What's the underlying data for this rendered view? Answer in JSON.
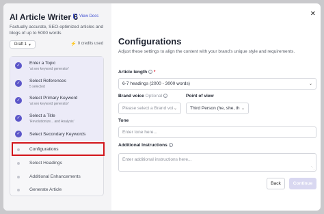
{
  "sidebar": {
    "title": "AI Article Writer 6",
    "docs_link": "View Docs",
    "description": "Factually accurate, SEO-optimized articles and blogs of up to 5000 words",
    "draft_label": "Draft 1",
    "credits_label": "0 credits used",
    "steps": [
      {
        "title": "Enter a Topic",
        "subtitle": "'ai seo keyword generator'",
        "status": "done"
      },
      {
        "title": "Select References",
        "subtitle": "5 selected",
        "status": "done"
      },
      {
        "title": "Select Primary Keyword",
        "subtitle": "'ai seo keyword generator'",
        "status": "done"
      },
      {
        "title": "Select a Title",
        "subtitle": "'Revolutionize... and Analysis'",
        "status": "done"
      },
      {
        "title": "Select Secondary Keywords",
        "subtitle": "",
        "status": "done"
      },
      {
        "title": "Configurations",
        "subtitle": "",
        "status": "current"
      },
      {
        "title": "Select Headings",
        "subtitle": "",
        "status": "pending"
      },
      {
        "title": "Additional Enhancements",
        "subtitle": "",
        "status": "pending"
      },
      {
        "title": "Generate Article",
        "subtitle": "",
        "status": "pending"
      }
    ]
  },
  "main": {
    "title": "Configurations",
    "subtitle": "Adjust these settings to align the content with your brand's unique style and requirements.",
    "article_length_label": "Article length",
    "article_length_value": "6-7 headings (2000 - 3000 words)",
    "brand_voice_label": "Brand voice",
    "brand_voice_optional": "Optional",
    "brand_voice_value": "Please select a Brand voi",
    "pov_label": "Point of view",
    "pov_value": "Third Person (he, she, th",
    "tone_label": "Tone",
    "tone_placeholder": "Enter tone here...",
    "instructions_label": "Additional Instructions",
    "instructions_placeholder": "Enter additional instructions here...",
    "back_label": "Back",
    "continue_label": "Continue"
  },
  "colors": {
    "accent": "#5b55c9",
    "highlight": "#d2141a",
    "link": "#3b4bd0"
  }
}
